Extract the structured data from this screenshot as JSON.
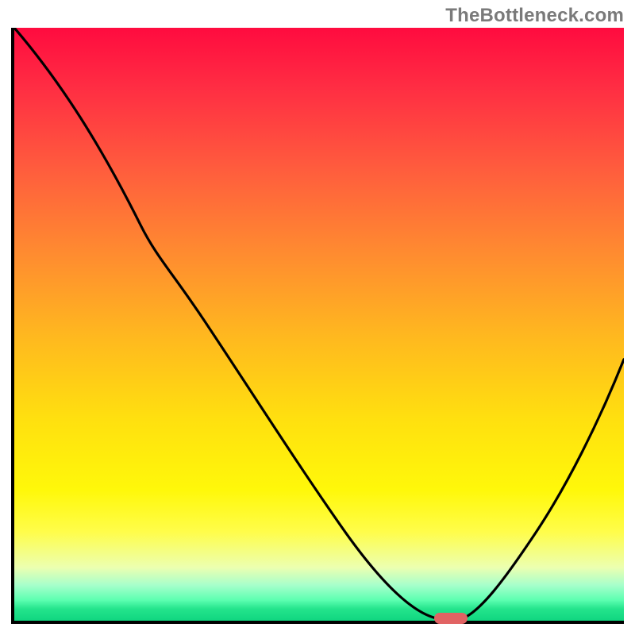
{
  "watermark": "TheBottleneck.com",
  "chart_data": {
    "type": "line",
    "title": "",
    "xlabel": "",
    "ylabel": "",
    "x": [
      0.0,
      0.05,
      0.1,
      0.15,
      0.2,
      0.25,
      0.3,
      0.35,
      0.4,
      0.45,
      0.5,
      0.55,
      0.6,
      0.65,
      0.7,
      0.72,
      0.75,
      0.8,
      0.85,
      0.9,
      0.95,
      1.0
    ],
    "values": [
      1.0,
      0.92,
      0.83,
      0.74,
      0.67,
      0.62,
      0.53,
      0.44,
      0.36,
      0.27,
      0.19,
      0.11,
      0.05,
      0.015,
      0.0,
      0.0,
      0.02,
      0.09,
      0.17,
      0.26,
      0.35,
      0.45
    ],
    "xlim": [
      0,
      1
    ],
    "ylim": [
      0,
      1
    ],
    "marker_x": 0.71,
    "marker_y": 0.0,
    "gradient_meaning": "red=high bottleneck, green=low bottleneck",
    "curve_description": "V-shaped bottleneck curve descending from top-left, reaching minimum near x≈0.71, then rising to the right edge"
  },
  "colors": {
    "border": "#000000",
    "curve": "#000000",
    "marker": "#e16363",
    "watermark": "#7a7a7a"
  }
}
